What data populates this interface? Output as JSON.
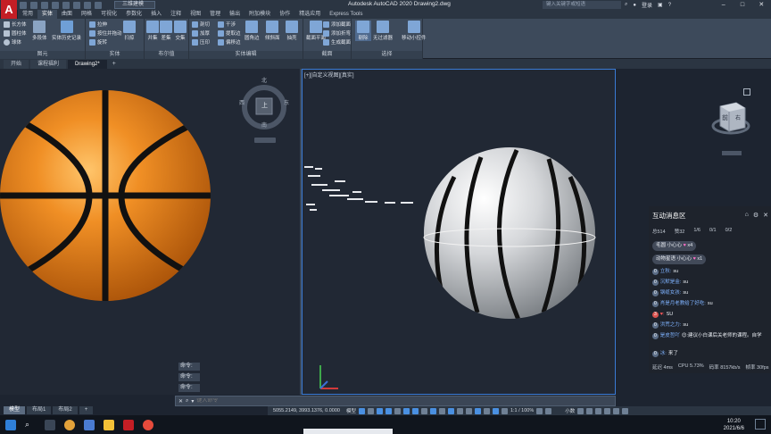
{
  "title_bar": {
    "app_letter": "A",
    "workspace": "三维建模",
    "title": "Autodesk AutoCAD 2020    Drawing2.dwg",
    "search_placeholder": "键入关键字或短语",
    "user": "登录"
  },
  "ribbon_tabs": [
    "常用",
    "实体",
    "曲面",
    "网格",
    "可视化",
    "参数化",
    "插入",
    "注释",
    "视图",
    "管理",
    "输出",
    "附加模块",
    "协作",
    "精选应用",
    "Express Tools"
  ],
  "ribbon_active_tab": "实体",
  "ribbon": {
    "primitive": {
      "items": [
        "长方体",
        "圆柱体",
        "球体"
      ],
      "big": "多段体",
      "history": "实体历史记录",
      "title": "图元"
    },
    "solid": {
      "items": [
        "拉伸",
        "放样",
        "旋转"
      ],
      "items2": [
        "按住并拖动",
        "扫掠"
      ],
      "title": "实体"
    },
    "boolean": {
      "items": [
        "并集",
        "差集",
        "交集"
      ],
      "title": "布尔值"
    },
    "solid_edit": {
      "items": [
        "剖切",
        "加厚",
        "压印"
      ],
      "items2": [
        "干涉",
        "提取边",
        "偏移边"
      ],
      "big1": "圆角边",
      "big2": "倾斜面",
      "big3": "抽壳",
      "title": "实体编辑"
    },
    "section": {
      "big": "截面平面",
      "items": [
        "添加截面",
        "添加折弯",
        "生成截面"
      ],
      "title": "截面"
    },
    "selection": {
      "big1": "剔除",
      "big2": "无过滤器",
      "big3": "移动小控件",
      "title": "选择"
    }
  },
  "file_tabs": [
    "开始",
    "课程福利",
    "Drawing2*"
  ],
  "viewport_label": "[+][自定义视图][真实]",
  "compass": {
    "north": "北",
    "south": "南",
    "east": "东",
    "west": "西",
    "top": "上"
  },
  "viewcube": {
    "front": "前",
    "right": "右"
  },
  "command": {
    "history": [
      "命令:",
      "命令:",
      "命令:"
    ],
    "placeholder": "键入命令"
  },
  "layout_tabs": [
    "模型",
    "布局1",
    "布局2"
  ],
  "status": {
    "coords": "5055.2149, 3993.1376, 0.0000",
    "mode": "模型",
    "scale": "1:1 / 100%",
    "units": "小数"
  },
  "chat": {
    "title": "互动消息区",
    "stats": [
      "总514",
      "赞32",
      "1/6",
      "0/1",
      "0/2"
    ],
    "gifts": [
      {
        "user": "毛圆",
        "name": "小心心",
        "count": "x4"
      },
      {
        "user": "动物星语",
        "name": "小心心",
        "count": "x1"
      }
    ],
    "messages": [
      {
        "level": "0",
        "user": "立秋:",
        "text": "su"
      },
      {
        "level": "0",
        "user": "沉默是金:",
        "text": "su"
      },
      {
        "level": "0",
        "user": "钢缆女孩:",
        "text": "su"
      },
      {
        "level": "0",
        "user": "肖是月老教给了好吃:",
        "text": "su"
      },
      {
        "level": "3",
        "user": "♥:",
        "text": "SU"
      },
      {
        "level": "0",
        "user": "洪荒之力:",
        "text": "su"
      },
      {
        "level": "0",
        "user": "是皮哲吖",
        "text": "😊:建议小白课后关老师的课程。自学"
      },
      {
        "level": "0",
        "user": "冰:",
        "text": "来了"
      }
    ],
    "footer": [
      "延迟 4ms",
      "CPU 5.73%",
      "码率 8157kb/s",
      "帧率 30fps"
    ]
  },
  "taskbar": {
    "time": "10:20",
    "date": "2021/6/6"
  },
  "colors": {
    "accent": "#3a7bd5",
    "basketball": "#e8811d",
    "logo": "#c41e25"
  }
}
